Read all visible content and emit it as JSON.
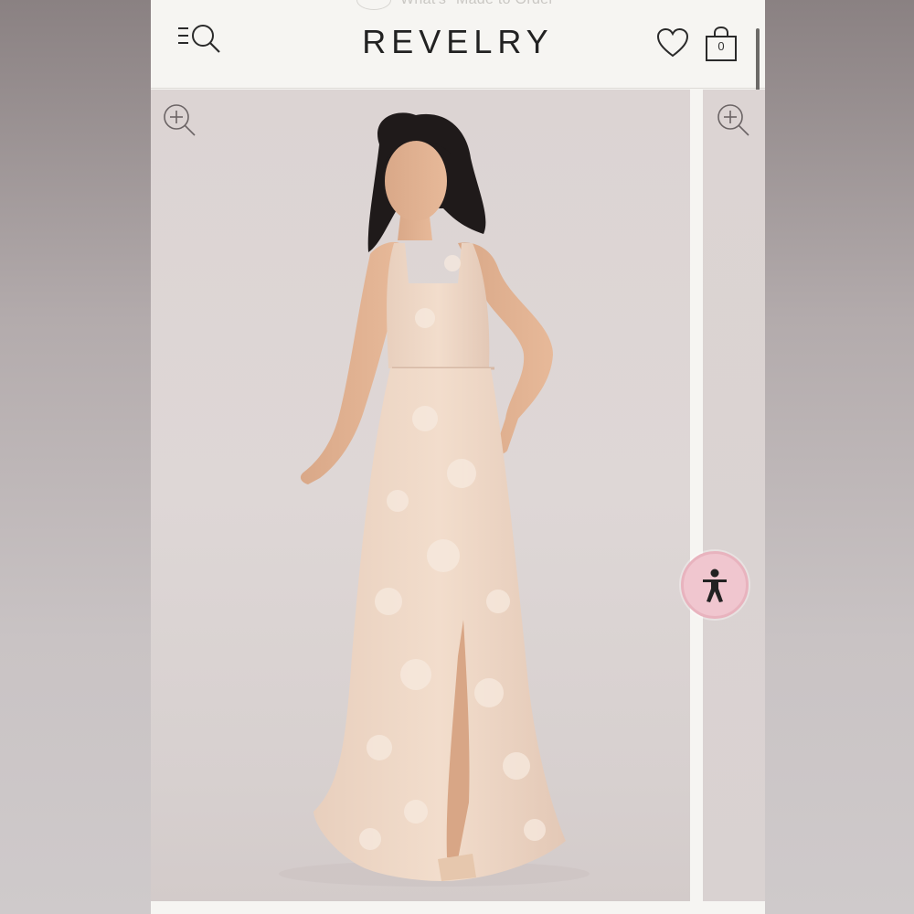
{
  "header": {
    "promo_text": "What's \"Made to Order\"",
    "brand": "REVELRY",
    "bag_count": "0"
  },
  "icons": {
    "menu": "menu-search-icon",
    "wishlist": "heart-icon",
    "bag": "shopping-bag-icon",
    "zoom": "zoom-in-icon",
    "accessibility": "accessibility-icon"
  },
  "colors": {
    "accessibility_button": "#f0c6cf",
    "page_background": "#f6f5f2",
    "photo_background": "#ddd5d4"
  }
}
